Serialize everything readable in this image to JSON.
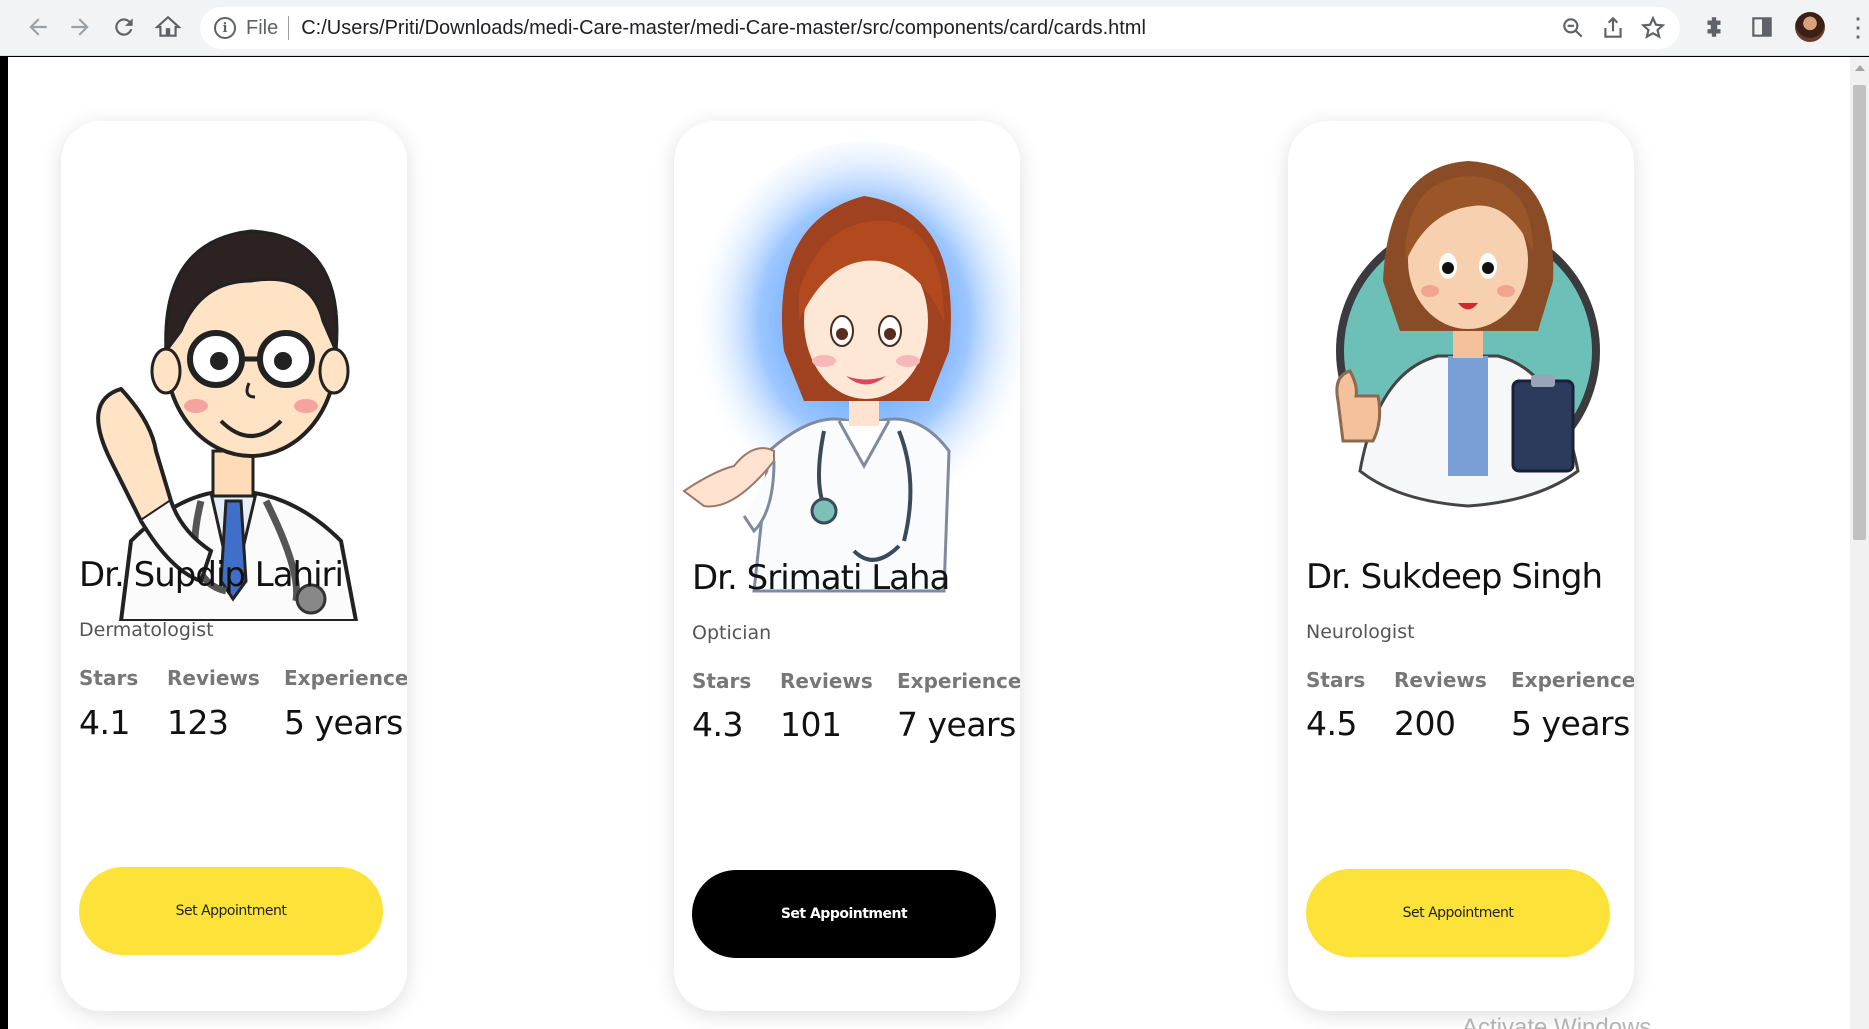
{
  "browser": {
    "scheme_label": "File",
    "url": "C:/Users/Priti/Downloads/medi-Care-master/medi-Care-master/src/components/card/cards.html"
  },
  "cards": [
    {
      "name": "Dr. Supdip Lahiri",
      "specialty": "Dermatologist",
      "stars_label": "Stars",
      "reviews_label": "Reviews",
      "experience_label": "Experience",
      "stars": "4.1",
      "reviews": "123",
      "experience": "5 years",
      "button_label": "Set Appointment",
      "button_color": "#fde23a",
      "button_text_color": "#222222"
    },
    {
      "name": "Dr. Srimati Laha",
      "specialty": "Optician",
      "stars_label": "Stars",
      "reviews_label": "Reviews",
      "experience_label": "Experience",
      "stars": "4.3",
      "reviews": "101",
      "experience": "7 years",
      "button_label": "Set Appointment",
      "button_color": "#000000",
      "button_text_color": "#ffffff"
    },
    {
      "name": "Dr. Sukdeep Singh",
      "specialty": "Neurologist",
      "stars_label": "Stars",
      "reviews_label": "Reviews",
      "experience_label": "Experience",
      "stars": "4.5",
      "reviews": "200",
      "experience": "5 years",
      "button_label": "Set Appointment",
      "button_color": "#fde23a",
      "button_text_color": "#222222"
    }
  ],
  "watermark": "Activate Windows"
}
